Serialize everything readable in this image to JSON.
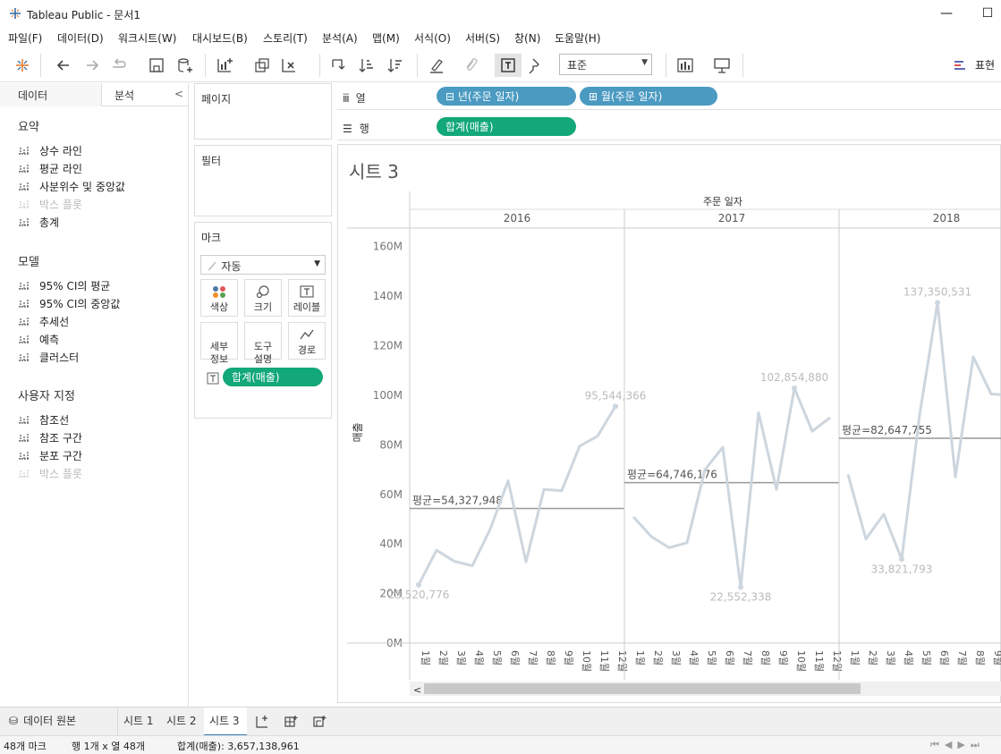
{
  "window": {
    "title": "Tableau Public - 문서1",
    "minimize": "—",
    "maximize": "☐"
  },
  "menu": [
    "파일(F)",
    "데이터(D)",
    "워크시트(W)",
    "대시보드(B)",
    "스토리(T)",
    "분석(A)",
    "맵(M)",
    "서식(O)",
    "서버(S)",
    "창(N)",
    "도움말(H)"
  ],
  "toolbar": {
    "format_select": "표준",
    "present_label": "표현"
  },
  "left_pane": {
    "tab_data": "데이터",
    "tab_analytics": "분석",
    "collapse": "<",
    "summary_title": "요약",
    "summary_items": [
      {
        "label": "상수 라인",
        "dim": false
      },
      {
        "label": "평균 라인",
        "dim": false
      },
      {
        "label": "사분위수 및 중앙값",
        "dim": false
      },
      {
        "label": "박스 플롯",
        "dim": true
      },
      {
        "label": "총계",
        "dim": false
      }
    ],
    "model_title": "모델",
    "model_items": [
      {
        "label": "95% CI의 평균",
        "dim": false
      },
      {
        "label": "95% CI의 중앙값",
        "dim": false
      },
      {
        "label": "추세선",
        "dim": false
      },
      {
        "label": "예측",
        "dim": false
      },
      {
        "label": "클러스터",
        "dim": false
      }
    ],
    "custom_title": "사용자 지정",
    "custom_items": [
      {
        "label": "참조선",
        "dim": false
      },
      {
        "label": "참조 구간",
        "dim": false
      },
      {
        "label": "분포 구간",
        "dim": false
      },
      {
        "label": "박스 플롯",
        "dim": true
      }
    ]
  },
  "cards": {
    "pages": "페이지",
    "filters": "필터",
    "marks": "마크",
    "marks_type": "자동",
    "mark_buttons": {
      "color": "색상",
      "size": "크기",
      "label": "레이블",
      "detail": "세부\n정보",
      "tooltip": "도구\n설명",
      "path": "경로"
    },
    "marks_pill": "합계(매출)"
  },
  "shelves": {
    "columns_label": "열",
    "rows_label": "행",
    "column_pills": [
      "⊟ 년(주문 일자)",
      "⊞ 월(주문 일자)"
    ],
    "row_pills": [
      "합계(매출)"
    ]
  },
  "sheet_title": "시트 3",
  "chart_data": {
    "type": "line",
    "header_title": "주문 일자",
    "ylabel": "매출",
    "ylim": [
      0,
      170000000
    ],
    "y_ticks": [
      "0M",
      "20M",
      "40M",
      "60M",
      "80M",
      "100M",
      "120M",
      "140M",
      "160M"
    ],
    "y_tick_values": [
      0,
      20000000,
      40000000,
      60000000,
      80000000,
      100000000,
      120000000,
      140000000,
      160000000
    ],
    "x_tick_labels": [
      "1월",
      "2월",
      "3월",
      "4월",
      "5월",
      "6월",
      "7월",
      "8월",
      "9월",
      "10월",
      "11월",
      "12월"
    ],
    "panes": [
      {
        "year": "2016",
        "values": [
          23520776,
          37500000,
          33000000,
          31200000,
          46000000,
          65500000,
          32800000,
          62000000,
          61500000,
          79500000,
          83500000,
          95544366
        ],
        "average": 54327948,
        "avg_label": "평균=54,327,948",
        "labels": [
          {
            "month_index": 0,
            "text": "23,520,776"
          },
          {
            "month_index": 11,
            "text": "95,544,366"
          }
        ]
      },
      {
        "year": "2017",
        "values": [
          51000000,
          43000000,
          38500000,
          40500000,
          70000000,
          79000000,
          22552338,
          93000000,
          62000000,
          102854880,
          85500000,
          91000000
        ],
        "average": 64746176,
        "avg_label": "평균=64,746,176",
        "labels": [
          {
            "month_index": 6,
            "text": "22,552,338"
          },
          {
            "month_index": 9,
            "text": "102,854,880"
          }
        ]
      },
      {
        "year": "2018",
        "values": [
          68000000,
          42000000,
          52000000,
          33821793,
          92000000,
          137350531,
          67000000,
          115500000,
          100500000,
          100000000
        ],
        "average": 82647755,
        "avg_label": "평균=82,647,755",
        "labels": [
          {
            "month_index": 3,
            "text": "33,821,793"
          },
          {
            "month_index": 5,
            "text": "137,350,531"
          }
        ]
      }
    ]
  },
  "sheet_tabs": {
    "datasource": "데이터 원본",
    "tabs": [
      "시트 1",
      "시트 2",
      "시트 3"
    ],
    "active": "시트 3"
  },
  "status": {
    "marks": "48개 마크",
    "rows_cols": "행 1개 x 열 48개",
    "sum": "합계(매출): 3,657,138,961"
  }
}
